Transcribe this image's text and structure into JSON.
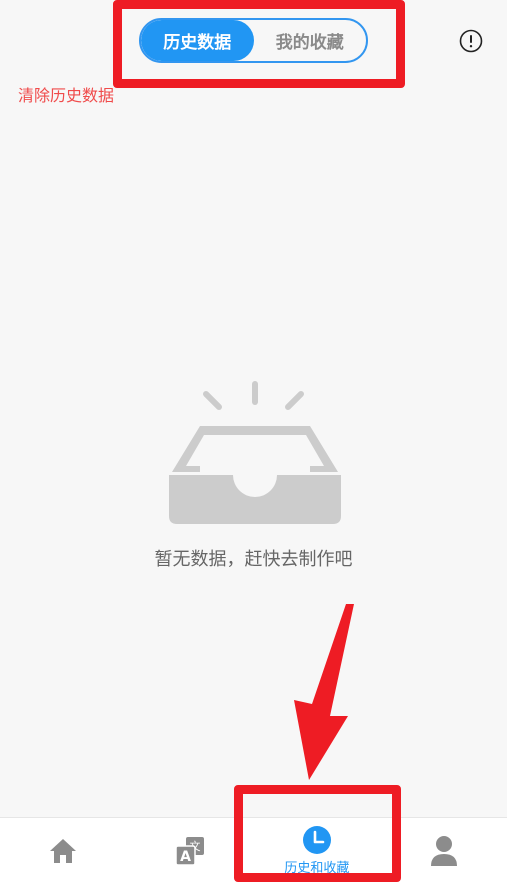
{
  "header": {
    "segment": {
      "tabs": [
        {
          "label": "历史数据",
          "active": true
        },
        {
          "label": "我的收藏",
          "active": false
        }
      ]
    },
    "info_icon": "info-circle-icon"
  },
  "clear_history_label": "清除历史数据",
  "empty_state": {
    "icon": "empty-inbox-icon",
    "message": "暂无数据，赶快去制作吧"
  },
  "tabbar": {
    "items": [
      {
        "icon": "home-icon",
        "label": "",
        "active": false
      },
      {
        "icon": "translate-icon",
        "label": "",
        "active": false
      },
      {
        "icon": "clock-icon",
        "label": "历史和收藏",
        "active": true
      },
      {
        "icon": "user-icon",
        "label": "",
        "active": false
      }
    ]
  },
  "colors": {
    "accent": "#2196f3",
    "danger_text": "#f04b4b",
    "annotation": "#ee1c24",
    "icon_gray": "#8c8c8c"
  }
}
